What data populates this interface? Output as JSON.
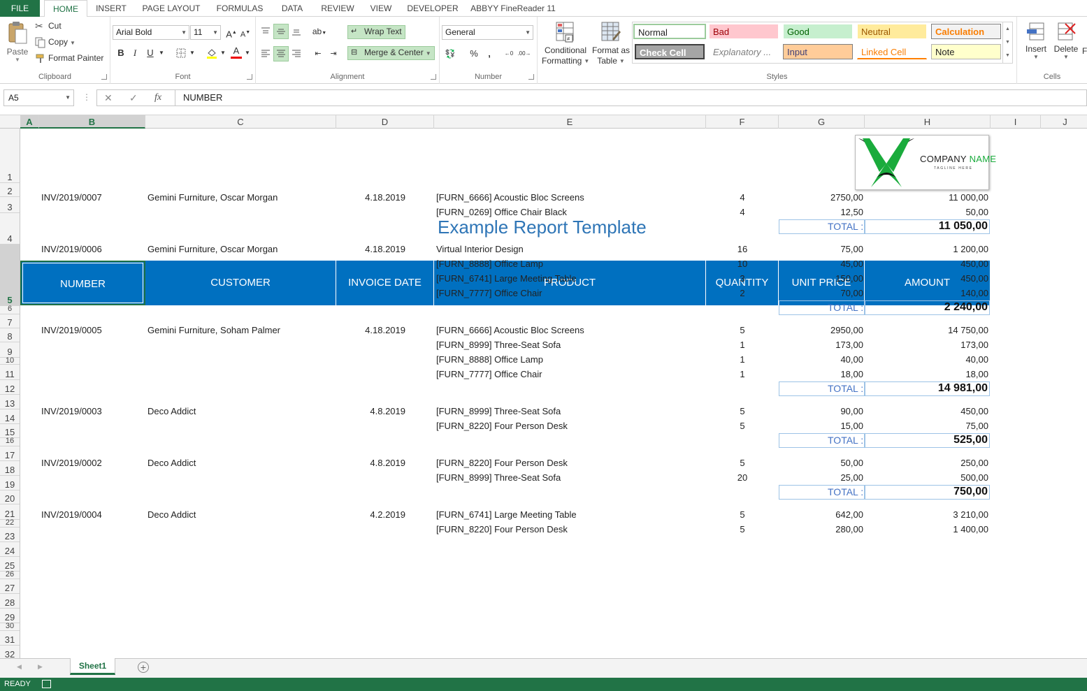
{
  "menu": {
    "file": "FILE",
    "tabs": [
      "HOME",
      "INSERT",
      "PAGE LAYOUT",
      "FORMULAS",
      "DATA",
      "REVIEW",
      "VIEW",
      "DEVELOPER",
      "ABBYY FineReader 11"
    ]
  },
  "ribbon": {
    "clipboard": {
      "paste": "Paste",
      "cut": "Cut",
      "copy": "Copy",
      "format_painter": "Format Painter",
      "label": "Clipboard"
    },
    "font": {
      "name": "Arial Bold",
      "size": "11",
      "label": "Font"
    },
    "alignment": {
      "wrap_text": "Wrap Text",
      "merge_center": "Merge & Center",
      "label": "Alignment"
    },
    "number": {
      "format": "General",
      "label": "Number"
    },
    "styles": {
      "conditional_formatting_1": "Conditional",
      "conditional_formatting_2": "Formatting",
      "format_as_table_1": "Format as",
      "format_as_table_2": "Table",
      "label": "Styles",
      "normal": "Normal",
      "bad": "Bad",
      "good": "Good",
      "neutral": "Neutral",
      "calculation": "Calculation",
      "check_cell": "Check Cell",
      "explanatory": "Explanatory ...",
      "input": "Input",
      "linked_cell": "Linked Cell",
      "note": "Note"
    },
    "cells": {
      "insert": "Insert",
      "delete": "Delete",
      "format_partial": "F",
      "label": "Cells"
    }
  },
  "formula_bar": {
    "name_box": "A5",
    "fx": "fx",
    "content": "NUMBER"
  },
  "columns": [
    "A",
    "B",
    "C",
    "D",
    "E",
    "F",
    "G",
    "H",
    "I",
    "J"
  ],
  "rows": [
    "1",
    "2",
    "3",
    "4",
    "5",
    "6",
    "7",
    "8",
    "9",
    "10",
    "11",
    "12",
    "13",
    "14",
    "15",
    "16",
    "17",
    "18",
    "19",
    "20",
    "21",
    "22",
    "23",
    "24",
    "25",
    "26",
    "27",
    "28",
    "29",
    "30",
    "31",
    "32"
  ],
  "logo": {
    "company": "COMPANY",
    "name": "NAME",
    "tagline": "TAGLINE HERE"
  },
  "report": {
    "title": "Example Report Template",
    "headers": [
      "NUMBER",
      "CUSTOMER",
      "INVOICE DATE",
      "PRODUCT",
      "QUANTITY",
      "UNIT PRICE",
      "AMOUNT"
    ],
    "total_label": "TOTAL :",
    "invoices": [
      {
        "number": "INV/2019/0007",
        "customer": "Gemini Furniture, Oscar Morgan",
        "date": "4.18.2019",
        "lines": [
          {
            "product": "[FURN_6666] Acoustic Bloc Screens",
            "qty": "4",
            "unit": "2750,00",
            "amount": "11 000,00"
          },
          {
            "product": "[FURN_0269] Office Chair Black",
            "qty": "4",
            "unit": "12,50",
            "amount": "50,00"
          }
        ],
        "total": "11 050,00"
      },
      {
        "number": "INV/2019/0006",
        "customer": "Gemini Furniture, Oscar Morgan",
        "date": "4.18.2019",
        "lines": [
          {
            "product": "Virtual Interior Design",
            "qty": "16",
            "unit": "75,00",
            "amount": "1 200,00"
          },
          {
            "product": "[FURN_8888] Office Lamp",
            "qty": "10",
            "unit": "45,00",
            "amount": "450,00"
          },
          {
            "product": "[FURN_6741] Large Meeting Table",
            "qty": "3",
            "unit": "150,00",
            "amount": "450,00"
          },
          {
            "product": "[FURN_7777] Office Chair",
            "qty": "2",
            "unit": "70,00",
            "amount": "140,00"
          }
        ],
        "total": "2 240,00"
      },
      {
        "number": "INV/2019/0005",
        "customer": "Gemini Furniture, Soham Palmer",
        "date": "4.18.2019",
        "lines": [
          {
            "product": "[FURN_6666] Acoustic Bloc Screens",
            "qty": "5",
            "unit": "2950,00",
            "amount": "14 750,00"
          },
          {
            "product": "[FURN_8999] Three-Seat Sofa",
            "qty": "1",
            "unit": "173,00",
            "amount": "173,00"
          },
          {
            "product": "[FURN_8888] Office Lamp",
            "qty": "1",
            "unit": "40,00",
            "amount": "40,00"
          },
          {
            "product": "[FURN_7777] Office Chair",
            "qty": "1",
            "unit": "18,00",
            "amount": "18,00"
          }
        ],
        "total": "14 981,00"
      },
      {
        "number": "INV/2019/0003",
        "customer": "Deco Addict",
        "date": "4.8.2019",
        "lines": [
          {
            "product": "[FURN_8999] Three-Seat Sofa",
            "qty": "5",
            "unit": "90,00",
            "amount": "450,00"
          },
          {
            "product": "[FURN_8220] Four Person Desk",
            "qty": "5",
            "unit": "15,00",
            "amount": "75,00"
          }
        ],
        "total": "525,00"
      },
      {
        "number": "INV/2019/0002",
        "customer": "Deco Addict",
        "date": "4.8.2019",
        "lines": [
          {
            "product": "[FURN_8220] Four Person Desk",
            "qty": "5",
            "unit": "50,00",
            "amount": "250,00"
          },
          {
            "product": "[FURN_8999] Three-Seat Sofa",
            "qty": "20",
            "unit": "25,00",
            "amount": "500,00"
          }
        ],
        "total": "750,00"
      },
      {
        "number": "INV/2019/0004",
        "customer": "Deco Addict",
        "date": "4.2.2019",
        "lines": [
          {
            "product": "[FURN_6741] Large Meeting Table",
            "qty": "5",
            "unit": "642,00",
            "amount": "3 210,00"
          },
          {
            "product": "[FURN_8220] Four Person Desk",
            "qty": "5",
            "unit": "280,00",
            "amount": "1 400,00"
          }
        ],
        "total": null
      }
    ]
  },
  "sheet_tab": "Sheet1",
  "status": "READY",
  "colors": {
    "excel_green": "#217346",
    "header_blue": "#0070c0",
    "title_blue": "#2e75b6",
    "total_label_blue": "#4472c4",
    "logo_green": "#1aab3c"
  }
}
